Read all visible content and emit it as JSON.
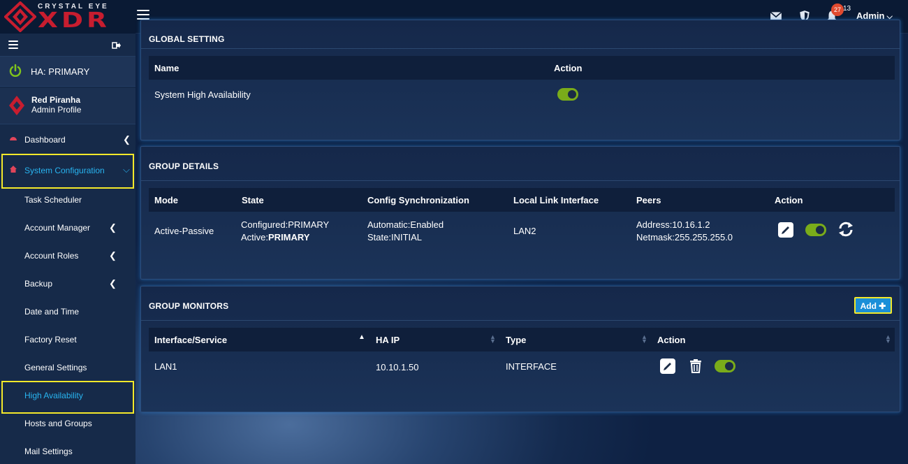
{
  "app": {
    "brand_top": "CRYSTAL EYE",
    "brand_main": "XDR"
  },
  "topbar": {
    "notification_count": "27",
    "notification_tail": "13",
    "user": "Admin"
  },
  "sidebar": {
    "ha_status": "HA: PRIMARY",
    "profile_name": "Red Piranha",
    "profile_role": "Admin Profile",
    "items": [
      {
        "label": "Dashboard"
      },
      {
        "label": "System Configuration"
      },
      {
        "label": "Task Scheduler"
      },
      {
        "label": "Account Manager"
      },
      {
        "label": "Account Roles"
      },
      {
        "label": "Backup"
      },
      {
        "label": "Date and Time"
      },
      {
        "label": "Factory Reset"
      },
      {
        "label": "General Settings"
      },
      {
        "label": "High Availability"
      },
      {
        "label": "Hosts and Groups"
      },
      {
        "label": "Mail Settings"
      }
    ]
  },
  "global_setting": {
    "title": "GLOBAL SETTING",
    "headers": [
      "Name",
      "Action"
    ],
    "row": {
      "name": "System High Availability"
    }
  },
  "group_details": {
    "title": "GROUP DETAILS",
    "headers": [
      "Mode",
      "State",
      "Config Synchronization",
      "Local Link Interface",
      "Peers",
      "Action"
    ],
    "row": {
      "mode": "Active-Passive",
      "state_configured": "Configured:PRIMARY",
      "state_active_prefix": "Active:",
      "state_active_value": "PRIMARY",
      "sync_automatic": "Automatic:Enabled",
      "sync_state": "State:INITIAL",
      "interface": "LAN2",
      "peer_address": "Address:10.16.1.2",
      "peer_netmask": "Netmask:255.255.255.0"
    }
  },
  "group_monitors": {
    "title": "GROUP MONITORS",
    "add_label": "Add",
    "headers": [
      "Interface/Service",
      "HA IP",
      "Type",
      "Action"
    ],
    "rows": [
      {
        "interface": "LAN1",
        "ha_ip": "10.10.1.50",
        "type": "INTERFACE"
      }
    ]
  },
  "colors": {
    "accent": "#28b4f0",
    "toggle_on": "#7aac1a",
    "highlight": "#f4e92a",
    "brand_red": "#c81d2f"
  }
}
